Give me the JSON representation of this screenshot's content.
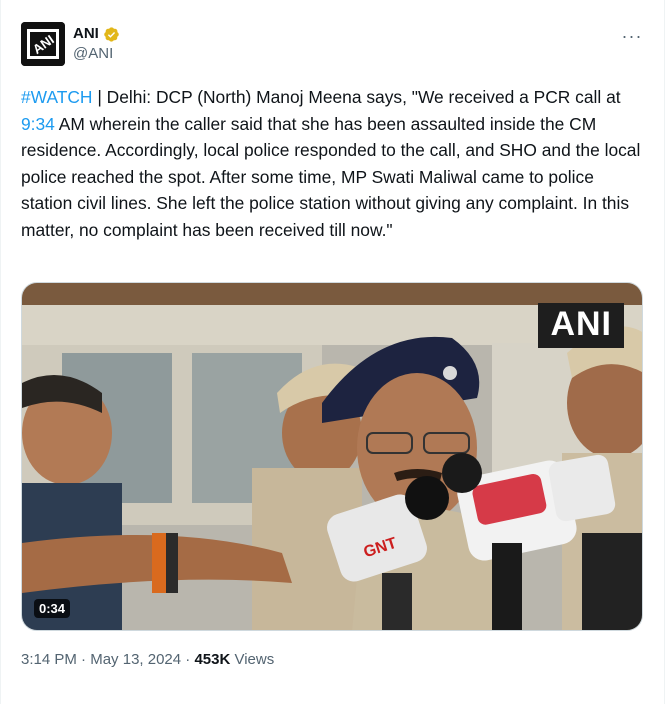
{
  "author": {
    "display_name": "ANI",
    "handle": "@ANI",
    "verified_color": "#e2b719",
    "avatar_text": "ANI"
  },
  "more_label": "···",
  "tweet": {
    "hashtag": "#WATCH",
    "body_part1": " | Delhi: DCP (North) Manoj Meena says, \"We received a PCR call at ",
    "time_link": "9:34",
    "body_part2": " AM wherein the caller said that she has been assaulted inside the CM residence. Accordingly, local police responded to the call, and SHO and the local police reached the spot. After some time, MP Swati Maliwal came to police station civil lines. She left the police station without giving any complaint. In this matter, no complaint has been received till now.\""
  },
  "media": {
    "watermark": "ANI",
    "duration": "0:34",
    "mic_label": "GNT"
  },
  "meta": {
    "time": "3:14 PM",
    "sep1": " · ",
    "date": "May 13, 2024",
    "sep2": " · ",
    "views_count": "453K",
    "views_label": " Views"
  },
  "colors": {
    "link": "#1d9bf0",
    "secondary": "#536471",
    "text": "#0f1419"
  }
}
